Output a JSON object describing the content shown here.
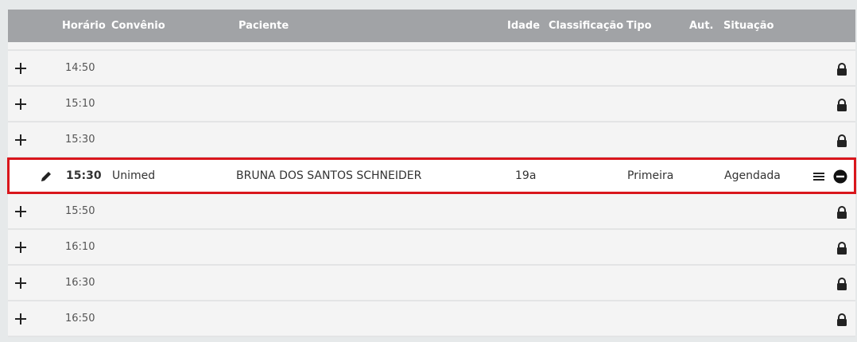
{
  "header": {
    "horario": "Horário",
    "convenio": "Convênio",
    "paciente": "Paciente",
    "idade": "Idade",
    "classificacao": "Classificação",
    "tipo": "Tipo",
    "aut": "Aut.",
    "situacao": "Situação"
  },
  "slots": [
    {
      "time": "14:50",
      "icon": "lock-icon",
      "action": "add-icon"
    },
    {
      "time": "15:10",
      "icon": "lock-icon",
      "action": "add-icon"
    },
    {
      "time": "15:30",
      "icon": "lock-icon",
      "action": "add-icon"
    }
  ],
  "appointment": {
    "time": "15:30",
    "convenio": "Unimed",
    "paciente": "BRUNA DOS SANTOS SCHNEIDER",
    "idade": "19a",
    "classificacao": "",
    "tipo": "Primeira",
    "aut": "",
    "situacao": "Agendada",
    "highlight_color": "#d9161c"
  },
  "slots_after": [
    {
      "time": "15:50",
      "icon": "lock-icon",
      "action": "add-icon"
    },
    {
      "time": "16:10",
      "icon": "lock-icon",
      "action": "add-icon"
    },
    {
      "time": "16:30",
      "icon": "lock-icon",
      "action": "add-icon"
    },
    {
      "time": "16:50",
      "icon": "lock-icon",
      "action": "add-icon"
    }
  ]
}
